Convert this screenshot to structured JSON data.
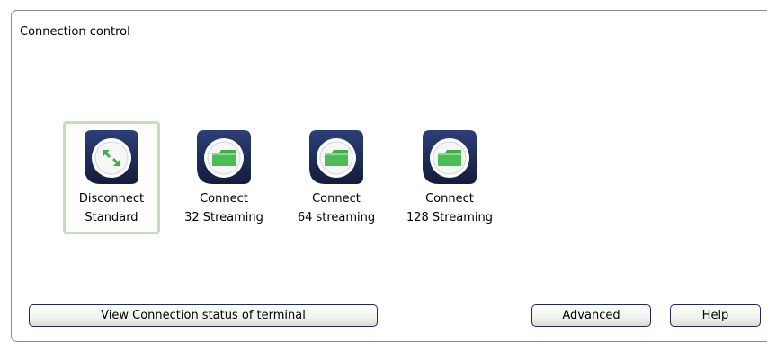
{
  "panel": {
    "title": "Connection control"
  },
  "tiles": [
    {
      "line1": "Disconnect",
      "line2": "Standard",
      "icon": "disconnect-arrows-icon",
      "selected": true
    },
    {
      "line1": "Connect",
      "line2": "32 Streaming",
      "icon": "folder-icon",
      "selected": false
    },
    {
      "line1": "Connect",
      "line2": "64 streaming",
      "icon": "folder-icon",
      "selected": false
    },
    {
      "line1": "Connect",
      "line2": "128 Streaming",
      "icon": "folder-icon",
      "selected": false
    }
  ],
  "buttons": {
    "view_status": "View Connection status of terminal",
    "advanced": "Advanced",
    "help": "Help"
  },
  "colors": {
    "icon_navy": "#1d2a55",
    "icon_green": "#3fae49",
    "selection_border": "#bfe1b5"
  }
}
